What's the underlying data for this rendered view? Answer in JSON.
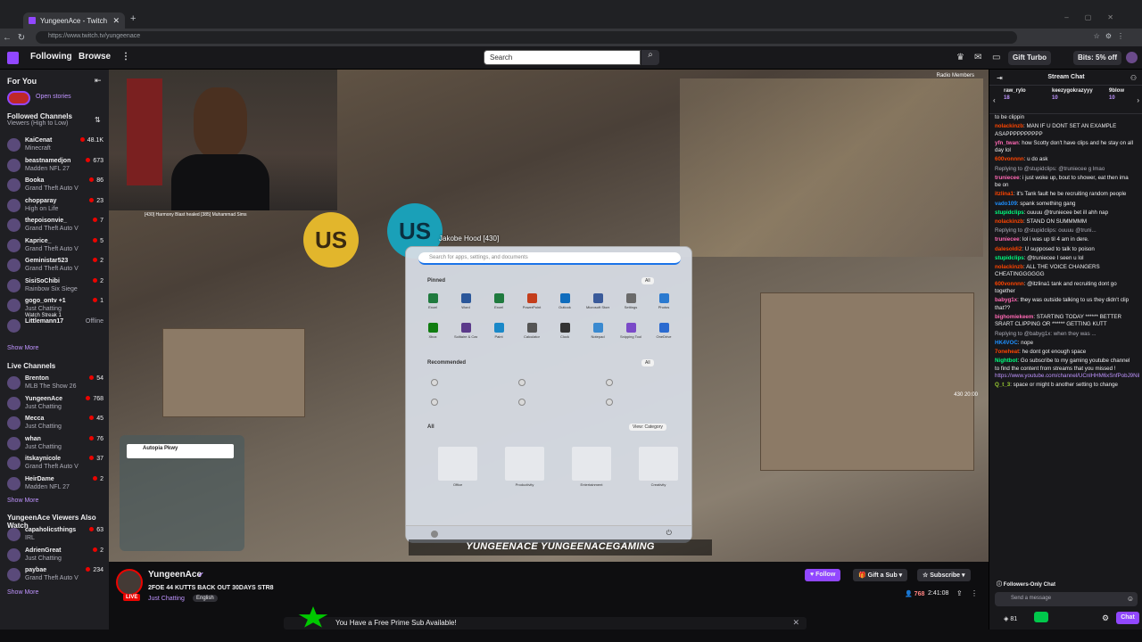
{
  "browser": {
    "tab_title": "YungeenAce - Twitch",
    "url": "https://www.twitch.tv/yungeenace"
  },
  "topnav": {
    "following": "Following",
    "browse": "Browse",
    "search_placeholder": "Search",
    "turbo": "Gift Turbo",
    "bits": "Bits: 5% off"
  },
  "sidebar": {
    "for_you": "For You",
    "open_stories": "Open stories",
    "followed_title": "Followed Channels",
    "followed_sort": "Viewers (High to Low)",
    "followed": [
      {
        "name": "KaiCenat",
        "game": "Minecraft",
        "viewers": "48.1K"
      },
      {
        "name": "beastnamedjon",
        "game": "Madden NFL 27",
        "viewers": "673"
      },
      {
        "name": "Booka",
        "game": "Grand Theft Auto V",
        "viewers": "86"
      },
      {
        "name": "chopparay",
        "game": "High on Life",
        "viewers": "23"
      },
      {
        "name": "thepoisonvie_",
        "game": "Grand Theft Auto V",
        "viewers": "7"
      },
      {
        "name": "Kaprice_",
        "game": "Grand Theft Auto V",
        "viewers": "5"
      },
      {
        "name": "Geministar523",
        "game": "Grand Theft Auto V",
        "viewers": "2"
      },
      {
        "name": "SisiSoChibi",
        "game": "Rainbow Six Siege",
        "viewers": "2"
      },
      {
        "name": "gogo_ontv +1",
        "game": "Just Chatting",
        "viewers": "1",
        "extra": "Watch Streak 1"
      },
      {
        "name": "Littlemann17",
        "game": "",
        "viewers": "Offline"
      }
    ],
    "show_more": "Show More",
    "live_title": "Live Channels",
    "live": [
      {
        "name": "Brenton",
        "game": "MLB The Show 26",
        "viewers": "54"
      },
      {
        "name": "YungeenAce",
        "game": "Just Chatting",
        "viewers": "768"
      },
      {
        "name": "Mecca",
        "game": "Just Chatting",
        "viewers": "45"
      },
      {
        "name": "whan",
        "game": "Just Chatting",
        "viewers": "76"
      },
      {
        "name": "itskaynicole",
        "game": "Grand Theft Auto V",
        "viewers": "37"
      },
      {
        "name": "HeirDame",
        "game": "Madden NFL 27",
        "viewers": "2"
      }
    ],
    "also_title": "YungeenAce Viewers Also Watch",
    "also": [
      {
        "name": "capaholicsthings",
        "game": "IRL",
        "viewers": "63"
      },
      {
        "name": "AdrienGreat",
        "game": "Just Chatting",
        "viewers": "2"
      },
      {
        "name": "paybae",
        "game": "Grand Theft Auto V",
        "viewers": "234"
      }
    ]
  },
  "video": {
    "player_name": "Jakobe Hood [430]",
    "killfeed": "[430] Harmony Blast healed [385] Muhammad Sims",
    "road": "Autopia Pkwy",
    "banner": "YUNGEENACE  YUNGEENACEGAMING",
    "radio": "Radio Members",
    "sign": "US",
    "hud_right": "430   20:00",
    "startmenu": {
      "search": "Search for apps, settings, and documents",
      "pinned": "Pinned",
      "all_apps": "All",
      "recommended": "Recommended",
      "all": "All",
      "view": "View: Category",
      "pinned_apps": [
        "Excel",
        "Word",
        "Excel",
        "PowerPoint",
        "Outlook",
        "Microsoft Store",
        "Settings",
        "Photos",
        "Xbox",
        "Solitaire & Casual Games",
        "Paint",
        "Calculator",
        "Clock",
        "Notepad",
        "Snipping Tool",
        "OneDrive"
      ],
      "categories": [
        "Office",
        "Productivity",
        "Entertainment",
        "Creativity"
      ]
    }
  },
  "channel": {
    "name": "YungeenAce",
    "live": "LIVE",
    "title": "2FOE 44 KUTTS BACK OUT 30DAYS STR8",
    "category": "Just Chatting",
    "language": "English",
    "follow": "Follow",
    "gift": "Gift a Sub",
    "subscribe": "Subscribe",
    "viewers": "768",
    "uptime": "2:41:08",
    "prime": "You Have a Free Prime Sub Available!"
  },
  "chat": {
    "header": "Stream Chat",
    "gifters": [
      {
        "name": "raw_rylo",
        "count": "18"
      },
      {
        "name": "keezygokrazyyy",
        "count": "10"
      },
      {
        "name": "9blow",
        "count": "10"
      }
    ],
    "messages": [
      {
        "user": "",
        "text": "to be clippin",
        "cls": "u1"
      },
      {
        "user": "nolackinzb",
        "text": "MAN IF U DONT SET AN EXAMPLE ASAPPPPPPPPPP",
        "cls": "u1"
      },
      {
        "user": "yfn_twan",
        "text": "how Scotty don't have clips and he stay on all day lol",
        "cls": "u4"
      },
      {
        "user": "600vonnnn",
        "text": "u do ask",
        "cls": "u1"
      },
      {
        "user": "",
        "text": "Replying to @stupidclips: @truniecee g lmao",
        "cls": "rep"
      },
      {
        "user": "truniecee",
        "text": "i just woke up, bout to shower, eat then ima be on",
        "cls": "u4"
      },
      {
        "user": "itzlina1",
        "text": "it's Tank fault he be recruiting random people",
        "cls": "u1"
      },
      {
        "user": "vado109",
        "text": "spank something gang",
        "cls": "u2"
      },
      {
        "user": "stupidclips",
        "text": "ouuuu @truniecee bet ill ahh nap",
        "cls": "u3"
      },
      {
        "user": "nolackinzb",
        "text": "STAND ON SUMMMMM",
        "cls": "u1"
      },
      {
        "user": "",
        "text": "Replying to @stupidclips: ouuuu @truni...",
        "cls": "rep"
      },
      {
        "user": "truniecee",
        "text": "lol i was up til 4 am in dere.",
        "cls": "u4"
      },
      {
        "user": "dalesoldi2",
        "text": "U supposed to talk to poison",
        "cls": "u1"
      },
      {
        "user": "stupidclips",
        "text": "@truniecee I seen u lol",
        "cls": "u3"
      },
      {
        "user": "nolackinzb",
        "text": "ALL THE VOICE CHANGERS CHEATINGGGGGG",
        "cls": "u1"
      },
      {
        "user": "600vonnnn",
        "text": "@itzlina1 tank and recruiting dont go together",
        "cls": "u1"
      },
      {
        "user": "babyg1x",
        "text": "they was outside talking to us they didn't clip that??",
        "cls": "u4"
      },
      {
        "user": "bighomiekeem",
        "text": "STARTING TODAY ****** BETTER SRART CLIPPING OR ****** GETTING KUTT",
        "cls": "u4"
      },
      {
        "user": "",
        "text": "Replying to @babyg1x: when they was ...",
        "cls": "rep"
      },
      {
        "user": "HK4VOC",
        "text": "nope",
        "cls": "u2"
      },
      {
        "user": "7oneheat",
        "text": "he dont got enough space",
        "cls": "u1"
      },
      {
        "user": "Nightbot",
        "text": "Go subscribe to my gaming youtube channel to find the content from streams that you missed !",
        "cls": "u3",
        "link": "https://www.youtube.com/channel/UCnlHHM6xSnfPobJ9NiLFvrw"
      },
      {
        "user": "Q_t_3",
        "text": "space or might b another setting to change",
        "cls": "u6"
      }
    ],
    "followers_only": "Followers-Only Chat",
    "placeholder": "Send a message",
    "points": "81",
    "chat_btn": "Chat"
  }
}
